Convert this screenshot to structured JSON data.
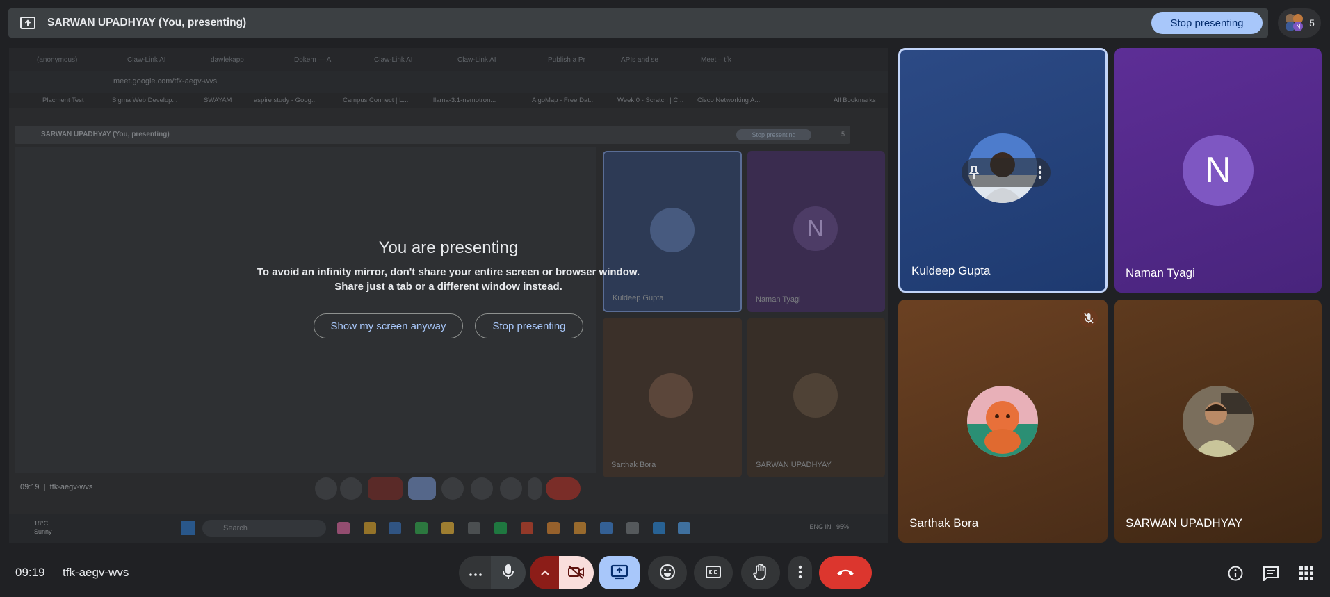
{
  "banner": {
    "title": "SARWAN UPADHYAY (You, presenting)",
    "stop_label": "Stop presenting",
    "people_count": "5"
  },
  "shared_screen": {
    "tabs": [
      "(anonymous)",
      "Claw-Link AI",
      "dawlekapp",
      "Dokem — Al",
      "Claw-Link AI",
      "Claw-Link AI",
      "Publish a Pr",
      "APIs and se",
      "Meet – tfk"
    ],
    "url": "meet.google.com/tfk-aegv-wvs",
    "bookmarks": [
      "Placment Test",
      "Sigma Web Develop...",
      "SWAYAM",
      "aspire study - Goog...",
      "Campus Connect | L...",
      "llama-3.1-nemotron...",
      "AlgoMap - Free Dat...",
      "Week 0 - Scratch | C...",
      "Cisco Networking A...",
      "All Bookmarks"
    ],
    "inner_banner_title": "SARWAN UPADHYAY (You, presenting)",
    "inner_stop_label": "Stop presenting",
    "inner_people_count": "5",
    "inner_tiles": [
      "Kuldeep Gupta",
      "Naman Tyagi",
      "Sarthak Bora",
      "SARWAN UPADHYAY"
    ],
    "inner_letter": "N",
    "inner_time": "09:19",
    "inner_code": "tfk-aegv-wvs",
    "taskbar": {
      "temp": "18°C",
      "weather": "Sunny",
      "search_placeholder": "Search",
      "lang": "ENG",
      "region": "IN",
      "battery": "95%"
    }
  },
  "overlay": {
    "title": "You are presenting",
    "line1": "To avoid an infinity mirror, don't share your entire screen or browser window.",
    "line2": "Share just a tab or a different window instead.",
    "show_anyway": "Show my screen anyway",
    "stop": "Stop presenting"
  },
  "participants": [
    {
      "name": "Kuldeep Gupta",
      "color": "#2c4a85"
    },
    {
      "name": "Naman Tyagi",
      "color": "#5d2e96",
      "initial": "N"
    },
    {
      "name": "Sarthak Bora",
      "color": "#6b4122",
      "muted": true
    },
    {
      "name": "SARWAN UPADHYAY",
      "color": "#5e3a1e"
    }
  ],
  "footer": {
    "time": "09:19",
    "meeting_code": "tfk-aegv-wvs"
  },
  "colors": {
    "accent": "#a8c7fa",
    "end_call": "#ea4335",
    "camera_off_bg": "#f9dedc",
    "camera_off_left": "#8c1d18"
  }
}
